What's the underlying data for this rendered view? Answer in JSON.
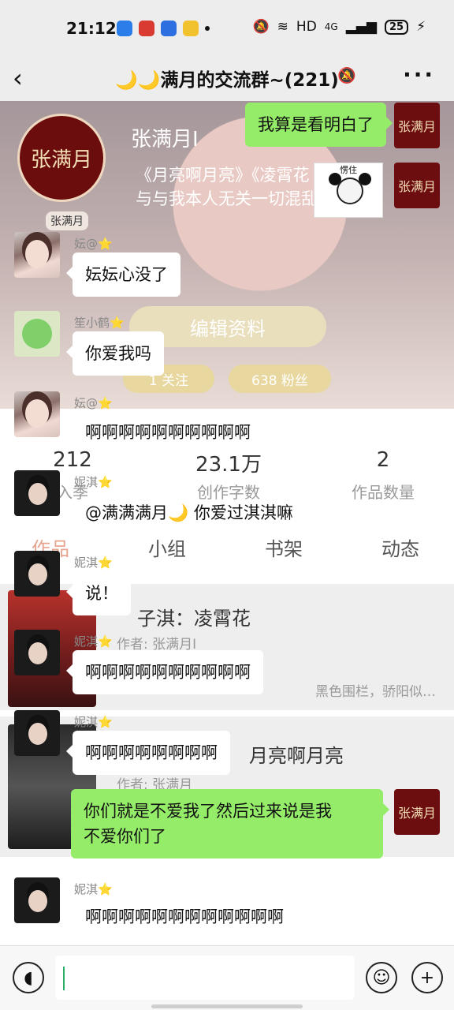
{
  "status_bar": {
    "time": "21:12",
    "network": "HD",
    "signal": "4G",
    "battery": "25"
  },
  "nav": {
    "back_icon": "chevron-left-icon",
    "title": "🌙🌙满月的交流群~(221)",
    "mute_icon": "bell-muted-icon",
    "more_icon": "more-dots-icon"
  },
  "background": {
    "profile_logo": "张满月",
    "profile_name": "张满月I",
    "profile_badge": "张满月",
    "intro_line1": "《月亮啊月亮》《凌霄花",
    "intro_line2": "与与我本人无关一切混乱",
    "edit_button": "编辑资料",
    "follow_pill": "1 关注",
    "fans_pill": "638 粉丝",
    "stats": [
      {
        "value": "212",
        "label": "入季"
      },
      {
        "value": "23.1万",
        "label": "创作字数"
      },
      {
        "value": "2",
        "label": "作品数量"
      }
    ],
    "tabs": [
      "作品",
      "小组",
      "书架",
      "动态"
    ],
    "works": [
      {
        "title": "子淇：凌霄花",
        "author": "作者: 张满月I",
        "desc": "黑色围栏，骄阳似…"
      },
      {
        "title": "月亮啊月亮",
        "author": "作者: 张满月",
        "desc": ""
      }
    ]
  },
  "messages": [
    {
      "side": "right",
      "text": "我算是看明白了"
    },
    {
      "side": "right",
      "sticker_caption": "愣住"
    },
    {
      "side": "left",
      "sender": "妘@⭐",
      "text": "妘妘心没了"
    },
    {
      "side": "left",
      "sender": "笙小鹤⭐",
      "text": "你爱我吗"
    },
    {
      "side": "left",
      "sender": "妘@⭐",
      "text": "啊啊啊啊啊啊啊啊啊啊"
    },
    {
      "side": "left",
      "sender": "妮淇⭐",
      "text": "@满满满月🌙 你爱过淇淇嘛"
    },
    {
      "side": "left",
      "sender": "妮淇⭐",
      "text": "说！"
    },
    {
      "side": "left",
      "sender": "妮淇⭐",
      "text": "啊啊啊啊啊啊啊啊啊啊"
    },
    {
      "side": "left",
      "sender": "妮淇⭐",
      "text": "啊啊啊啊啊啊啊啊"
    },
    {
      "side": "right",
      "text": "你们就是不爱我了然后过来说是我\n不爱你们了"
    },
    {
      "side": "left",
      "sender": "妮淇⭐",
      "text": "啊啊啊啊啊啊啊啊啊啊啊啊"
    }
  ],
  "input_bar": {
    "voice_icon": "voice-icon",
    "emoji_icon": "emoji-icon",
    "plus_icon": "plus-icon",
    "value": ""
  }
}
